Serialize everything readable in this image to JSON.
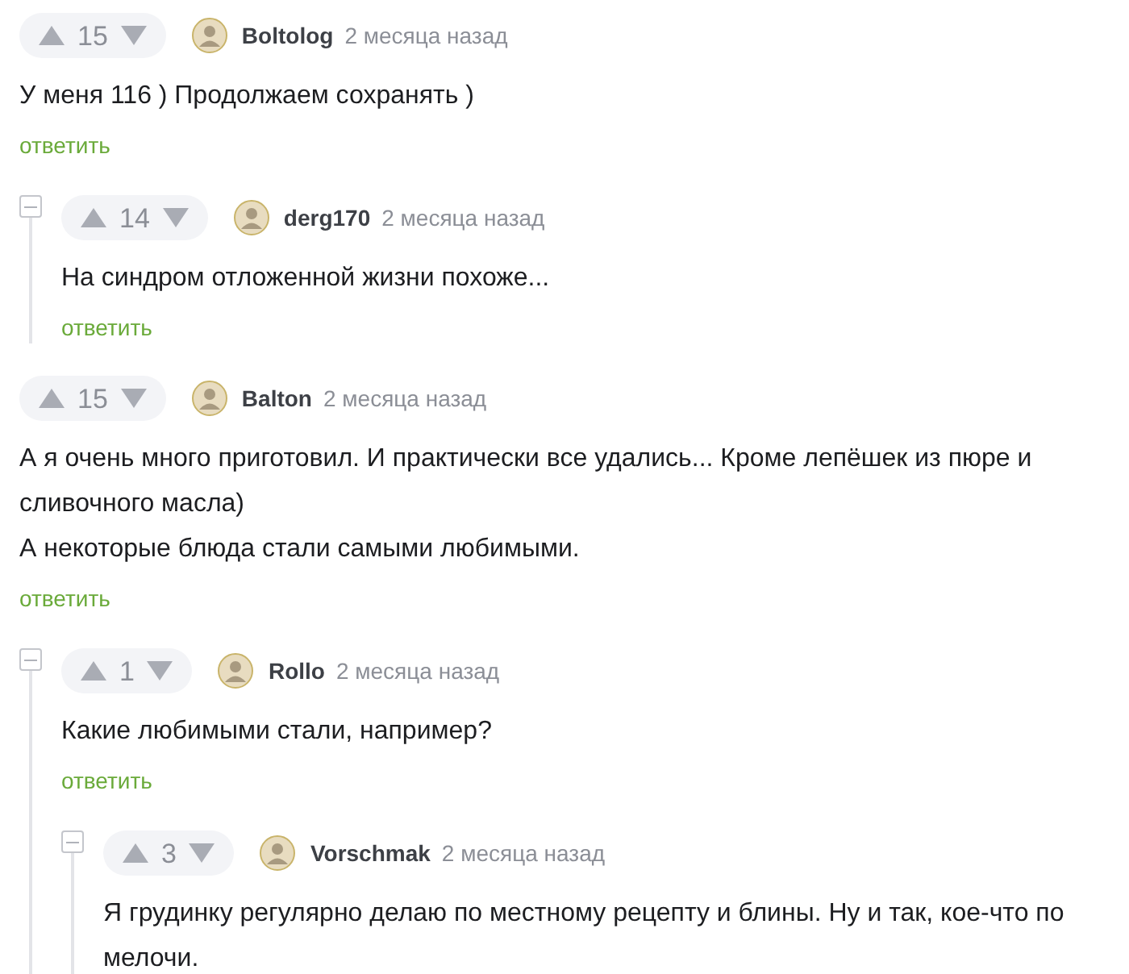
{
  "comments": [
    {
      "author": "Boltolog",
      "time": "2 месяца назад",
      "votes": "15",
      "paragraphs": [
        "У меня 116 ) Продолжаем сохранять )"
      ],
      "reply": "ответить",
      "children": [
        {
          "author": "derg170",
          "time": "2 месяца назад",
          "votes": "14",
          "paragraphs": [
            "На синдром отложенной жизни похоже..."
          ],
          "reply": "ответить",
          "expanded": true
        }
      ]
    },
    {
      "author": "Balton",
      "time": "2 месяца назад",
      "votes": "15",
      "paragraphs": [
        "А я очень много приготовил. И практически все удались... Кроме лепёшек из пюре и сливочного масла)",
        "А некоторые блюда стали самыми любимыми."
      ],
      "reply": "ответить",
      "children": [
        {
          "author": "Rollo",
          "time": "2 месяца назад",
          "votes": "1",
          "paragraphs": [
            "Какие любимыми стали, например?"
          ],
          "reply": "ответить",
          "expanded": true,
          "children": [
            {
              "author": "Vorschmak",
              "time": "2 месяца назад",
              "votes": "3",
              "paragraphs": [
                "Я грудинку регулярно делаю по местному рецепту и блины. Ну и так, кое-что по мелочи."
              ],
              "expanded": true
            }
          ]
        }
      ]
    }
  ]
}
